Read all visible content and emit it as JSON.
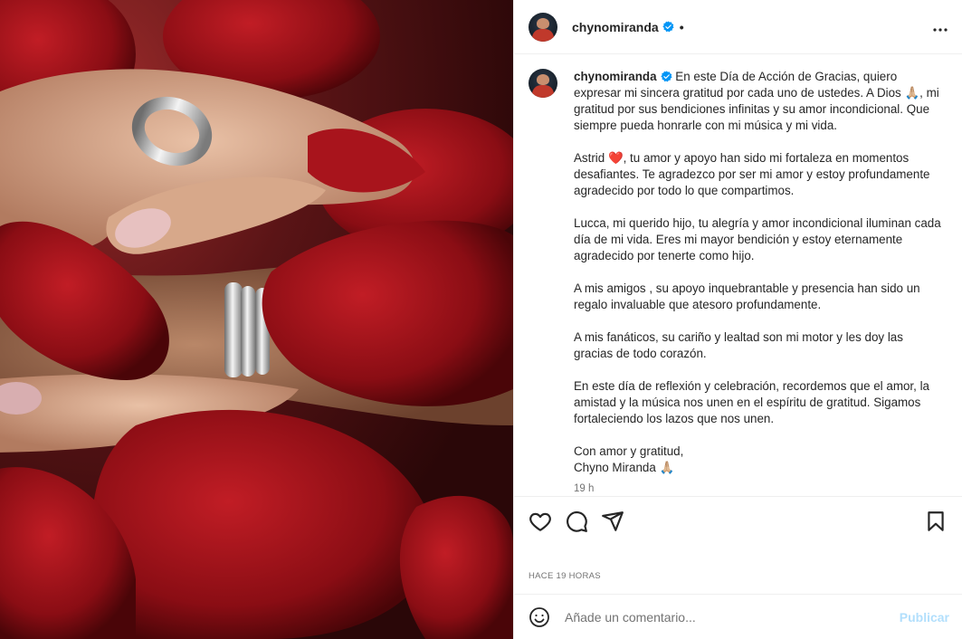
{
  "post": {
    "username": "chynomiranda",
    "header_dot": "•",
    "caption": "En este Día de Acción de Gracias, quiero expresar mi sincera gratitud por cada uno de ustedes. A Dios 🙏🏼, mi gratitud por sus bendiciones infinitas y su amor incondicional. Que siempre pueda honrarle con mi música y mi vida.\n\nAstrid ❤️, tu amor y apoyo han sido mi fortaleza en momentos desafiantes. Te agradezco por ser mi amor y estoy profundamente agradecido por todo lo que compartimos.\n\nLucca, mi querido hijo, tu alegría y amor incondicional iluminan cada día de mi vida. Eres mi mayor bendición y estoy eternamente agradecido por tenerte como hijo.\n\nA mis amigos , su apoyo inquebrantable y presencia han sido un regalo invaluable que atesoro profundamente.\n\nA mis fanáticos, su cariño y lealtad son mi motor y les doy las gracias de todo corazón.\n\nEn este día de reflexión y celebración, recordemos que el amor, la amistad y la música nos unen en el espíritu de gratitud. Sigamos fortaleciendo los lazos que nos unen.\n\nCon amor y gratitud,\nChyno Miranda 🙏🏼",
    "time_ago": "19 h",
    "date_label": "HACE 19 HORAS"
  },
  "comment": {
    "placeholder": "Añade un comentario...",
    "publish_label": "Publicar"
  },
  "icons": {
    "verified": "verified-badge-icon",
    "more": "more-options-icon",
    "like": "heart-icon",
    "comment": "comment-icon",
    "share": "share-icon",
    "save": "bookmark-icon",
    "emoji": "emoji-icon"
  },
  "colors": {
    "verified": "#0095f6",
    "publish": "#b2dffc",
    "secondary_text": "#737373"
  }
}
